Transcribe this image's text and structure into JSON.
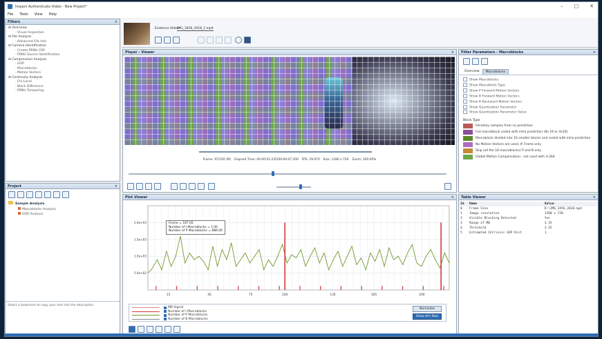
{
  "window": {
    "title": "Impact Authenticate Video - New Project*"
  },
  "menu": [
    "File",
    "Tools",
    "View",
    "Help"
  ],
  "filters": {
    "title": "Filters",
    "items": [
      {
        "label": "Overview",
        "level": 1
      },
      {
        "label": "Visual Inspection",
        "level": 2
      },
      {
        "label": "File Analysis",
        "level": 1
      },
      {
        "label": "Advanced File Info",
        "level": 2
      },
      {
        "label": "Camera Identification",
        "level": 1
      },
      {
        "label": "Create PRNU CRP",
        "level": 2
      },
      {
        "label": "PRNU Source Identification",
        "level": 2
      },
      {
        "label": "Compression Analysis",
        "level": 1
      },
      {
        "label": "GOP",
        "level": 2
      },
      {
        "label": "Macroblocks",
        "level": 2
      },
      {
        "label": "Motion Vectors",
        "level": 2
      },
      {
        "label": "Continuity Analysis",
        "level": 1
      },
      {
        "label": "Chi-Local",
        "level": 2
      },
      {
        "label": "Block Difference",
        "level": 2
      },
      {
        "label": "PRNU Tampering",
        "level": 2
      }
    ]
  },
  "project": {
    "title": "Project",
    "items": [
      "Sample Analysis",
      "Macroblocks Analysis",
      "GOP Analysis"
    ],
    "footer": "Select a bookmark to copy your text into the description"
  },
  "evidence": {
    "label": "Evidence Video:",
    "file": "IMG_3456_2018_1.mp4"
  },
  "player": {
    "title": "Player - Viewer",
    "status": {
      "frame": "Frame: 97/220 (M)",
      "elapsed": "Elapsed Time: 00:00:03.235/00:00:07.200",
      "fps": "FPS: 29.970",
      "size": "Size: 1280 x 720",
      "zoom": "Zoom: 100.00%"
    },
    "seek_position": 0.45,
    "volume": 0.65
  },
  "filter_params": {
    "title": "Filter Parameters - Macroblocks",
    "tabs": [
      "Overview",
      "Macroblocks"
    ],
    "active_tab": 1,
    "checks": [
      "Show Macroblocks",
      "Show Macroblock Type",
      "Show P Forward Motion Vectors",
      "Show B Forward Motion Vectors",
      "Show B Backward Motion Vectors",
      "Show Quantization Parameter",
      "Show Quantization Parameter Value"
    ],
    "block_type_label": "Block Type",
    "block_types": [
      {
        "label": "Intra/key samples from no prediction",
        "color": "#b85a5a"
      },
      {
        "label": "Full macroblock coded with intra prediction (8x 16 or 4x16)",
        "color": "#8a4f9a"
      },
      {
        "label": "Macroblock divided into 16 smaller blocks and coded with intra prediction",
        "color": "#5a8a2a"
      },
      {
        "label": "No Motion Vectors are used, IF Frame only",
        "color": "#b06cc0"
      },
      {
        "label": "Skip (all the 16 macroblocks) P and B only",
        "color": "#c48a3a"
      },
      {
        "label": "Global Motion Compensation - not used with H.264",
        "color": "#6aa84a"
      }
    ]
  },
  "plot": {
    "title": "Plot Viewer",
    "tooltip": [
      "Frame = 187.00",
      "Number of I Macroblocks = 1.00",
      "Number of P Macroblocks = 886.00"
    ],
    "legend": [
      "MB Signal",
      "Number of I Macroblocks",
      "Number of P Macroblocks",
      "Number of B Macroblocks"
    ],
    "buttons": [
      "Normalize",
      "Show All I Row"
    ]
  },
  "table_viewer": {
    "title": "Table Viewer",
    "columns": [
      "Id",
      "Name",
      "Value"
    ],
    "rows": [
      [
        "0",
        "Frame Size",
        "D:\\IMG_3456_2018.mp4"
      ],
      [
        "1",
        "Image resolution",
        "1280 x 720"
      ],
      [
        "2",
        "Visible Blocking Detected",
        "Yes"
      ],
      [
        "3",
        "Range of MB",
        "3.35"
      ],
      [
        "4",
        "Threshold",
        "3.35"
      ],
      [
        "5",
        "Estimated Intrinsic GOP Dist",
        "1"
      ]
    ]
  },
  "chart_data": {
    "type": "line",
    "title": "",
    "xlabel": "",
    "ylabel": "",
    "xlim": [
      0,
      220
    ],
    "ylim": [
      0,
      2500
    ],
    "x_ticks": [
      15,
      45,
      75,
      100,
      135,
      165,
      200
    ],
    "y_ticks": [
      "2.0e+03",
      "1.5e+03",
      "1.0e+03",
      "5.0e+02"
    ],
    "series": [
      {
        "name": "Number of P Macroblocks",
        "color": "#6f9a2a",
        "values": [
          500,
          650,
          900,
          600,
          1150,
          700,
          1000,
          1600,
          800,
          1100,
          900,
          1000,
          850,
          600,
          1300,
          700,
          1200,
          900,
          1400,
          700,
          900,
          1100,
          800,
          1000,
          1200,
          600,
          900,
          700,
          1000,
          1350,
          800,
          1050,
          950,
          1200,
          700,
          1000,
          1250,
          800,
          1100,
          600,
          900,
          1150,
          700,
          1000,
          1300,
          750,
          950,
          600,
          1100,
          850,
          1200,
          700,
          1250,
          900,
          1000,
          750,
          1100,
          1350,
          800,
          700,
          1000,
          1200,
          900,
          650,
          1100,
          800
        ]
      },
      {
        "name": "Number of I Macroblocks",
        "color": "#d43838",
        "spikes_x": [
          100,
          214
        ],
        "spike_value": 2000
      }
    ]
  }
}
